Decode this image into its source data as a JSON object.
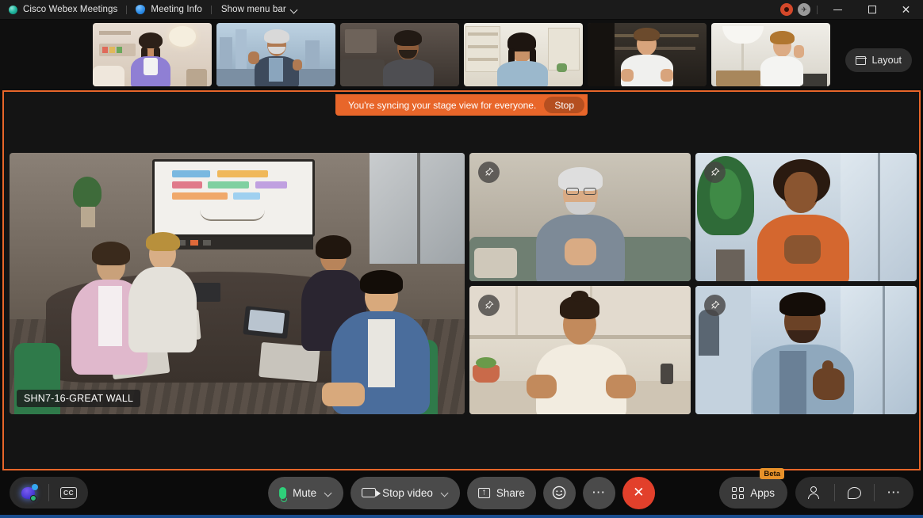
{
  "titlebar": {
    "app_icon": "webex-dot-icon",
    "app_name": "Cisco Webex Meetings",
    "meeting_info_icon": "shield-info-icon",
    "meeting_info_label": "Meeting Info",
    "menu_toggle_label": "Show menu bar",
    "menu_chevron_icon": "chevron-down-icon",
    "recording_icon": "recording-indicator-icon",
    "connection_icon": "connection-status-icon",
    "minimize_icon": "minimize-icon",
    "maximize_icon": "maximize-icon",
    "close_icon": "close-icon"
  },
  "filmstrip": {
    "layout_button": {
      "label": "Layout",
      "icon": "layout-grid-icon"
    },
    "thumbnails": [
      {
        "name": "participant-thumb-1",
        "bg": "#cbb9a8",
        "wall": "#e6dad0",
        "skin": "#c48c63",
        "shirt": "#8f7fd4",
        "hair": "#2c2018"
      },
      {
        "name": "participant-thumb-2",
        "bg": "#9fb4c8",
        "wall": "#b9cddd",
        "skin": "#b07a52",
        "shirt": "#3d4a5c",
        "hair": "#d9d9d9"
      },
      {
        "name": "participant-thumb-3",
        "bg": "#4a4340",
        "wall": "#5c5450",
        "skin": "#8d5c3a",
        "shirt": "#4e4e52",
        "hair": "#221a14"
      },
      {
        "name": "participant-thumb-4",
        "bg": "#d7d2c6",
        "wall": "#e4e0d6",
        "skin": "#c89268",
        "shirt": "#9bb8cc",
        "hair": "#1d1510"
      },
      {
        "name": "participant-thumb-5",
        "bg": "#2a2622",
        "wall": "#3a342e",
        "skin": "#d8a47c",
        "shirt": "#f0f0ee",
        "hair": "#6b4a2c"
      },
      {
        "name": "participant-thumb-6",
        "bg": "#dcd8cf",
        "wall": "#eceae4",
        "skin": "#dcab84",
        "shirt": "#f4f4f2",
        "hair": "#b0762f"
      }
    ]
  },
  "stage": {
    "sync_banner": {
      "message": "You're syncing your stage view for everyone.",
      "stop_label": "Stop"
    },
    "border_color": "#e8662a",
    "main_tile": {
      "name": "main-video-tile",
      "label": "SHN7-16-GREAT WALL",
      "room_bg": "#6b6257",
      "table": "#3b322c"
    },
    "side_tiles": [
      {
        "name": "video-tile-top-left",
        "pin_icon": "pin-icon",
        "bg": "#b9b2a6",
        "skin": "#d9ab84",
        "shirt": "#7d8a97",
        "hair": "#dedede"
      },
      {
        "name": "video-tile-top-right",
        "pin_icon": "pin-icon",
        "bg": "#c3d3e0",
        "skin": "#8a5530",
        "shirt": "#d4672f",
        "hair": "#2a1a10"
      },
      {
        "name": "video-tile-bottom-left",
        "pin_icon": "pin-icon",
        "bg": "#ddd6c9",
        "skin": "#c28a5c",
        "shirt": "#f2ece0",
        "hair": "#2b1d12"
      },
      {
        "name": "video-tile-bottom-right",
        "pin_icon": "pin-icon",
        "bg": "#b4c6d6",
        "skin": "#6b4226",
        "shirt": "#8fa8bd",
        "hair": "#140d08"
      }
    ]
  },
  "controls": {
    "assistant_icon": "webex-assistant-icon",
    "captions_icon": "closed-captions-icon",
    "captions_label": "CC",
    "mute": {
      "label": "Mute",
      "icon": "microphone-icon",
      "chevron": "chevron-down-icon"
    },
    "video": {
      "label": "Stop video",
      "icon": "camera-icon",
      "chevron": "chevron-down-icon"
    },
    "share": {
      "label": "Share",
      "icon": "share-screen-icon"
    },
    "reactions_icon": "emoji-reaction-icon",
    "more_icon": "more-options-icon",
    "end_call_icon": "end-call-icon",
    "apps": {
      "label": "Apps",
      "icon": "apps-grid-icon",
      "badge": "Beta"
    },
    "participants_icon": "participants-icon",
    "chat_icon": "chat-bubble-icon",
    "more_right_icon": "more-options-icon"
  }
}
